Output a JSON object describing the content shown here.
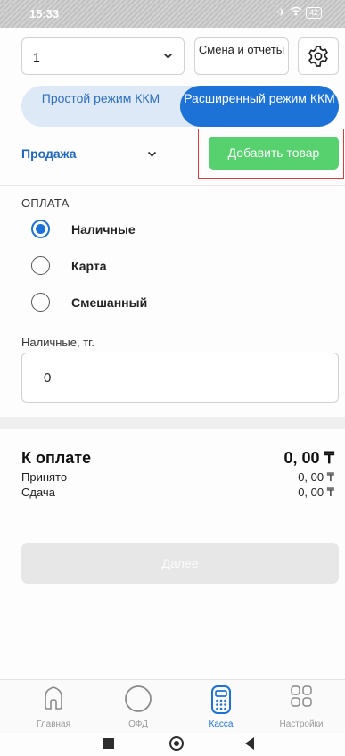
{
  "status_bar": {
    "time": "15:33",
    "battery": "42"
  },
  "header": {
    "register_select": "1",
    "shift_button": "Смена и отчеты"
  },
  "mode_toggle": {
    "simple": "Простой режим ККМ",
    "extended": "Расширенный режим ККМ",
    "selected": "extended"
  },
  "operation": {
    "selected": "Продажа"
  },
  "add_item_button": "Добавить товар",
  "payment": {
    "title": "ОПЛАТА",
    "options": [
      {
        "label": "Наличные",
        "checked": true
      },
      {
        "label": "Карта",
        "checked": false
      },
      {
        "label": "Смешанный",
        "checked": false
      }
    ],
    "cash_label": "Наличные, тг.",
    "cash_value": "0"
  },
  "summary": {
    "total_label": "К оплате",
    "total_value": "0, 00 ₸",
    "received_label": "Принято",
    "received_value": "0, 00 ₸",
    "change_label": "Сдача",
    "change_value": "0, 00 ₸"
  },
  "next_button": "Далее",
  "tabs": [
    {
      "label": "Главная",
      "icon": "home-icon"
    },
    {
      "label": "ОФД",
      "icon": "circle-icon"
    },
    {
      "label": "Касса",
      "icon": "calculator-icon",
      "active": true
    },
    {
      "label": "Настройки",
      "icon": "grid-icon"
    }
  ],
  "colors": {
    "accent": "#1c72d6",
    "add_button": "#57d06e",
    "highlight": "#e03b3b"
  }
}
